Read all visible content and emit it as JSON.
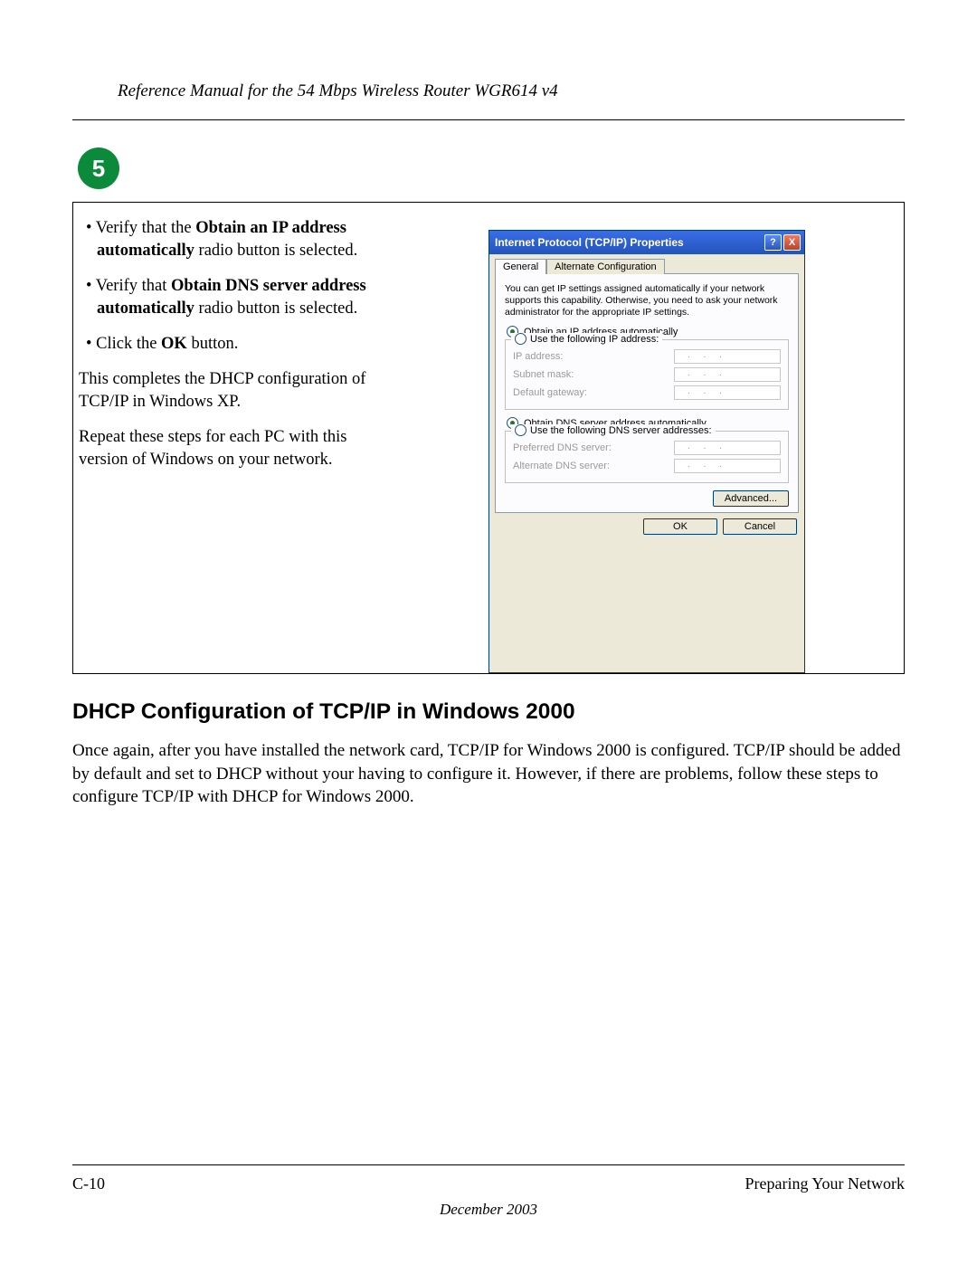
{
  "header": {
    "title": "Reference Manual for the 54 Mbps Wireless Router WGR614 v4"
  },
  "step": {
    "number": "5"
  },
  "instructions": {
    "bullet1_pre": "Verify that the ",
    "bullet1_bold": "Obtain an IP address automatically",
    "bullet1_post": " radio button is selected.",
    "bullet2_pre": "Verify that ",
    "bullet2_bold": "Obtain DNS server address automatically",
    "bullet2_post": " radio button is selected.",
    "bullet3_pre": "Click the ",
    "bullet3_bold": "OK",
    "bullet3_post": " button.",
    "para1": "This completes the DHCP configuration of TCP/IP in Windows XP.",
    "para2": "Repeat these steps for each PC with this version of Windows on your network."
  },
  "dialog": {
    "title": "Internet Protocol (TCP/IP) Properties",
    "help_btn": "?",
    "close_btn": "X",
    "tabs": {
      "general": "General",
      "alt": "Alternate Configuration"
    },
    "desc": "You can get IP settings assigned automatically if your network supports this capability. Otherwise, you need to ask your network administrator for the appropriate IP settings.",
    "radio_ip_auto": "Obtain an IP address automatically",
    "radio_ip_manual": "Use the following IP address:",
    "label_ip": "IP address:",
    "label_subnet": "Subnet mask:",
    "label_gateway": "Default gateway:",
    "radio_dns_auto": "Obtain DNS server address automatically",
    "radio_dns_manual": "Use the following DNS server addresses:",
    "label_pref_dns": "Preferred DNS server:",
    "label_alt_dns": "Alternate DNS server:",
    "ipdots": ".  .  .",
    "btn_advanced": "Advanced...",
    "btn_ok": "OK",
    "btn_cancel": "Cancel"
  },
  "section": {
    "heading": "DHCP Configuration of TCP/IP in Windows 2000",
    "para": "Once again, after you have installed the network card, TCP/IP for Windows 2000 is configured. TCP/IP should be added by default and set to DHCP without your having to configure it. However, if there are problems, follow these steps to configure TCP/IP with DHCP for Windows 2000."
  },
  "footer": {
    "page_num": "C-10",
    "section_name": "Preparing Your Network",
    "date": "December 2003"
  }
}
